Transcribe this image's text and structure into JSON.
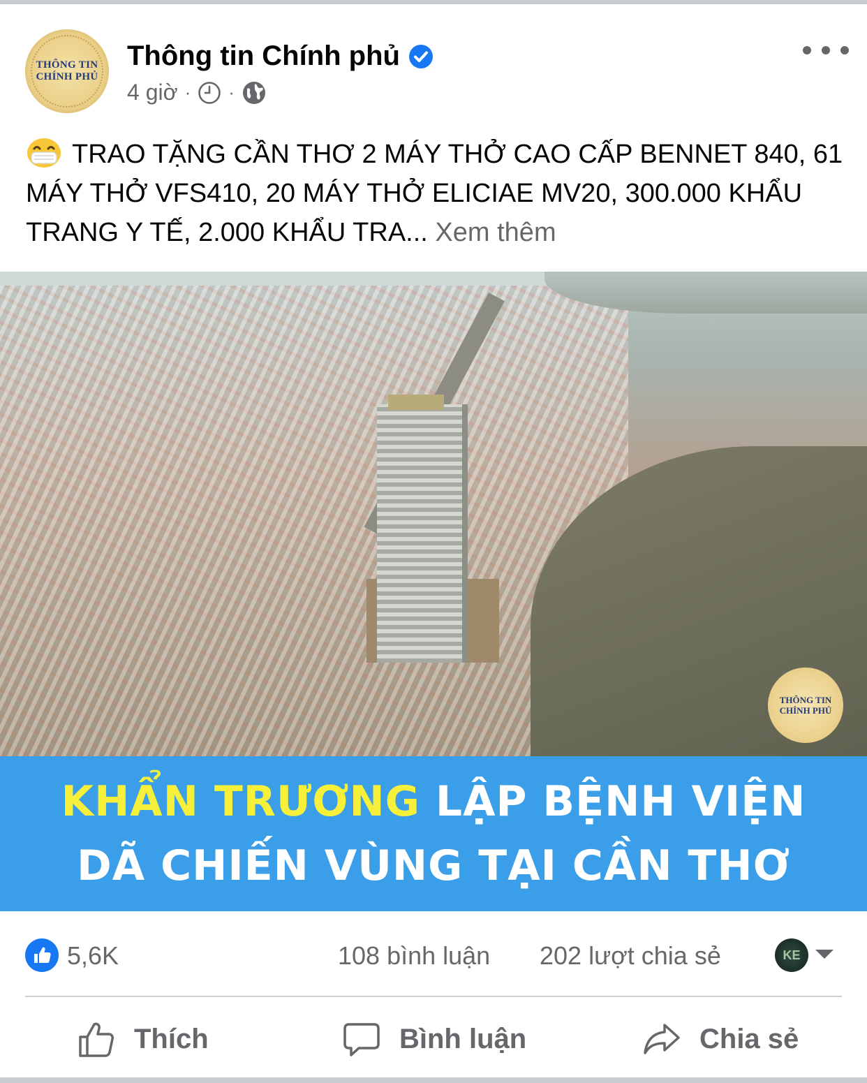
{
  "post": {
    "page_name": "Thông tin Chính phủ",
    "avatar_text": [
      "THÔNG TIN",
      "CHÍNH PHỦ"
    ],
    "time": "4 giờ",
    "separator": "·",
    "caption_text": "TRAO TẶNG CẦN THƠ 2 MÁY THỞ CAO CẤP BENNET 840, 61 MÁY THỞ VFS410, 20 MÁY THỞ ELICIAE MV20, 300.000 KHẨU TRANG Y TẾ, 2.000 KHẨU TRA...",
    "see_more": "Xem thêm",
    "icons": {
      "emoji": "mask-face-emoji-icon",
      "verified": "verified-badge-icon",
      "clock": "clock-icon",
      "audience": "globe-icon",
      "more": "more-dots-icon"
    }
  },
  "image": {
    "watermark_text": [
      "THÔNG TIN",
      "CHÍNH PHỦ"
    ],
    "headline_highlight": "KHẨN TRƯƠNG",
    "headline_rest": " LẬP BỆNH VIỆN",
    "headline_line2": "DÃ CHIẾN VÙNG TẠI CẦN THƠ",
    "banner_color": "#3a9ee8",
    "highlight_color": "#f6f03a"
  },
  "stats": {
    "likes": "5,6K",
    "comments": "108 bình luận",
    "shares": "202 lượt chia sẻ",
    "reactor_initials": "KE"
  },
  "actions": {
    "like": "Thích",
    "comment": "Bình luận",
    "share": "Chia sẻ"
  }
}
